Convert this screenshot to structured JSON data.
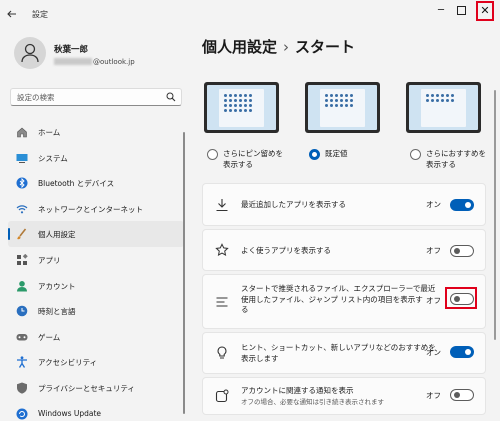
{
  "window": {
    "title": "設定",
    "back_icon": "back-arrow-icon",
    "minimize": "─",
    "maximize": "☐",
    "close": "✕"
  },
  "user": {
    "name": "秋葉一郎",
    "email_domain": "@outlook.jp"
  },
  "search": {
    "placeholder": "設定の検索",
    "icon": "search-icon"
  },
  "nav": {
    "items": [
      {
        "label": "ホーム",
        "icon": "home-icon",
        "active": false
      },
      {
        "label": "システム",
        "icon": "system-icon",
        "active": false
      },
      {
        "label": "Bluetooth とデバイス",
        "icon": "bluetooth-icon",
        "active": false
      },
      {
        "label": "ネットワークとインターネット",
        "icon": "wifi-icon",
        "active": false
      },
      {
        "label": "個人用設定",
        "icon": "brush-icon",
        "active": true
      },
      {
        "label": "アプリ",
        "icon": "apps-icon",
        "active": false
      },
      {
        "label": "アカウント",
        "icon": "account-icon",
        "active": false
      },
      {
        "label": "時刻と言語",
        "icon": "time-language-icon",
        "active": false
      },
      {
        "label": "ゲーム",
        "icon": "gamepad-icon",
        "active": false
      },
      {
        "label": "アクセシビリティ",
        "icon": "accessibility-icon",
        "active": false
      },
      {
        "label": "プライバシーとセキュリティ",
        "icon": "shield-icon",
        "active": false
      },
      {
        "label": "Windows Update",
        "icon": "update-icon",
        "active": false
      }
    ]
  },
  "breadcrumb": {
    "parent": "個人用設定",
    "separator": "›",
    "current": "スタート"
  },
  "layout_options": [
    {
      "label_line1": "さらにピン留めを",
      "label_line2": "表示する",
      "checked": false
    },
    {
      "label_line1": "既定値",
      "label_line2": "",
      "checked": true
    },
    {
      "label_line1": "さらにおすすめを",
      "label_line2": "表示する",
      "checked": false
    }
  ],
  "settings": [
    {
      "label": "最近追加したアプリを表示する",
      "state": "オン",
      "on": true,
      "icon": "download-icon"
    },
    {
      "label": "よく使うアプリを表示する",
      "state": "オフ",
      "on": false,
      "icon": "star-icon"
    },
    {
      "label_line1": "スタートで推奨されるファイル、エクスプローラーで最近",
      "label_line2": "使用したファイル、ジャンプ リスト内の項目を表示す",
      "label_line3": "る",
      "state": "オフ",
      "on": false,
      "icon": "list-icon"
    },
    {
      "label_line1": "ヒント、ショートカット、新しいアプリなどのおすすめを",
      "label_line2": "表示します",
      "state": "オン",
      "on": true,
      "icon": "lightbulb-icon"
    },
    {
      "label": "アカウントに関連する通知を表示",
      "sublabel": "オフの場合、必要な通知は引き続き表示されます",
      "state": "オフ",
      "on": false,
      "icon": "notification-icon"
    }
  ],
  "colors": {
    "accent": "#005fb8",
    "highlight": "#e0001b",
    "background": "#f3f3f3",
    "card": "#fbfbfb"
  }
}
